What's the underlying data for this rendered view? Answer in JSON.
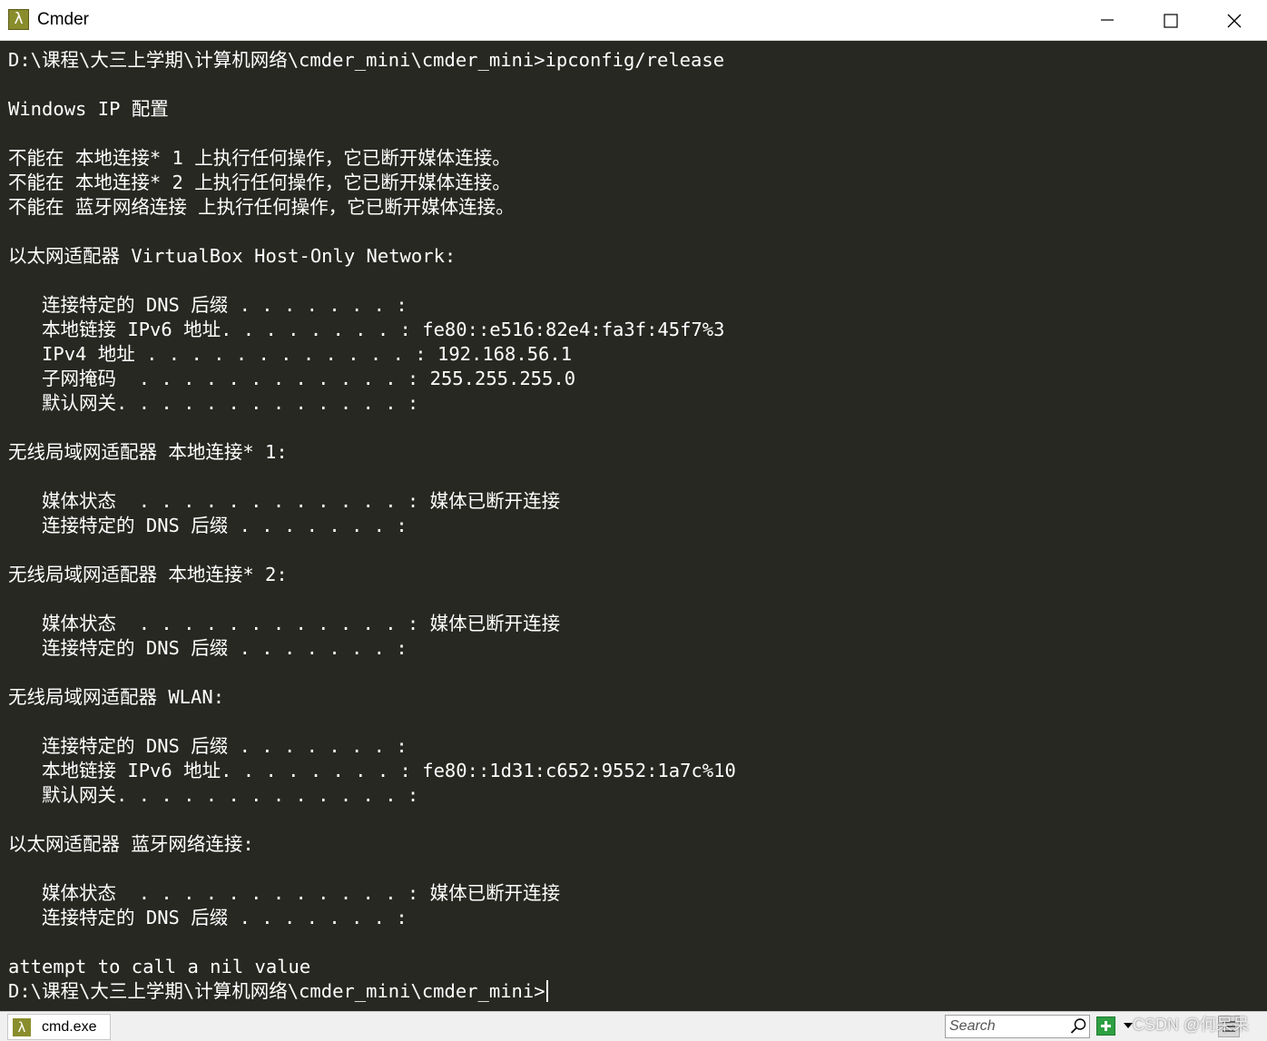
{
  "window": {
    "title": "Cmder",
    "app_icon_glyph": "λ",
    "controls": {
      "minimize": "minimize-icon",
      "maximize": "maximize-icon",
      "close": "close-icon"
    }
  },
  "console": {
    "lines": [
      "D:\\课程\\大三上学期\\计算机网络\\cmder_mini\\cmder_mini>ipconfig/release",
      "",
      "Windows IP 配置",
      "",
      "不能在 本地连接* 1 上执行任何操作，它已断开媒体连接。",
      "不能在 本地连接* 2 上执行任何操作，它已断开媒体连接。",
      "不能在 蓝牙网络连接 上执行任何操作，它已断开媒体连接。",
      "",
      "以太网适配器 VirtualBox Host-Only Network:",
      "",
      "   连接特定的 DNS 后缀 . . . . . . . :",
      "   本地链接 IPv6 地址. . . . . . . . : fe80::e516:82e4:fa3f:45f7%3",
      "   IPv4 地址 . . . . . . . . . . . . : 192.168.56.1",
      "   子网掩码  . . . . . . . . . . . . : 255.255.255.0",
      "   默认网关. . . . . . . . . . . . . :",
      "",
      "无线局域网适配器 本地连接* 1:",
      "",
      "   媒体状态  . . . . . . . . . . . . : 媒体已断开连接",
      "   连接特定的 DNS 后缀 . . . . . . . :",
      "",
      "无线局域网适配器 本地连接* 2:",
      "",
      "   媒体状态  . . . . . . . . . . . . : 媒体已断开连接",
      "   连接特定的 DNS 后缀 . . . . . . . :",
      "",
      "无线局域网适配器 WLAN:",
      "",
      "   连接特定的 DNS 后缀 . . . . . . . :",
      "   本地链接 IPv6 地址. . . . . . . . : fe80::1d31:c652:9552:1a7c%10",
      "   默认网关. . . . . . . . . . . . . :",
      "",
      "以太网适配器 蓝牙网络连接:",
      "",
      "   媒体状态  . . . . . . . . . . . . : 媒体已断开连接",
      "   连接特定的 DNS 后缀 . . . . . . . :",
      "",
      "attempt to call a nil value"
    ],
    "prompt": "D:\\课程\\大三上学期\\计算机网络\\cmder_mini\\cmder_mini>"
  },
  "tabbar": {
    "tab_label": "cmd.exe",
    "tab_icon_glyph": "λ",
    "search_placeholder": "Search",
    "search_icon": "search-icon",
    "add_tab_icon": "plus-icon",
    "dropdown_icon": "chevron-down-icon",
    "watermark": "CSDN @何呆呆",
    "tools_icon": "menu-icon"
  },
  "colors": {
    "console_background": "#272822",
    "console_text": "#ffffff",
    "titlebar_background": "#ffffff",
    "tabbar_background": "#f0f0f0",
    "add_tab_green": "#2ea043"
  }
}
